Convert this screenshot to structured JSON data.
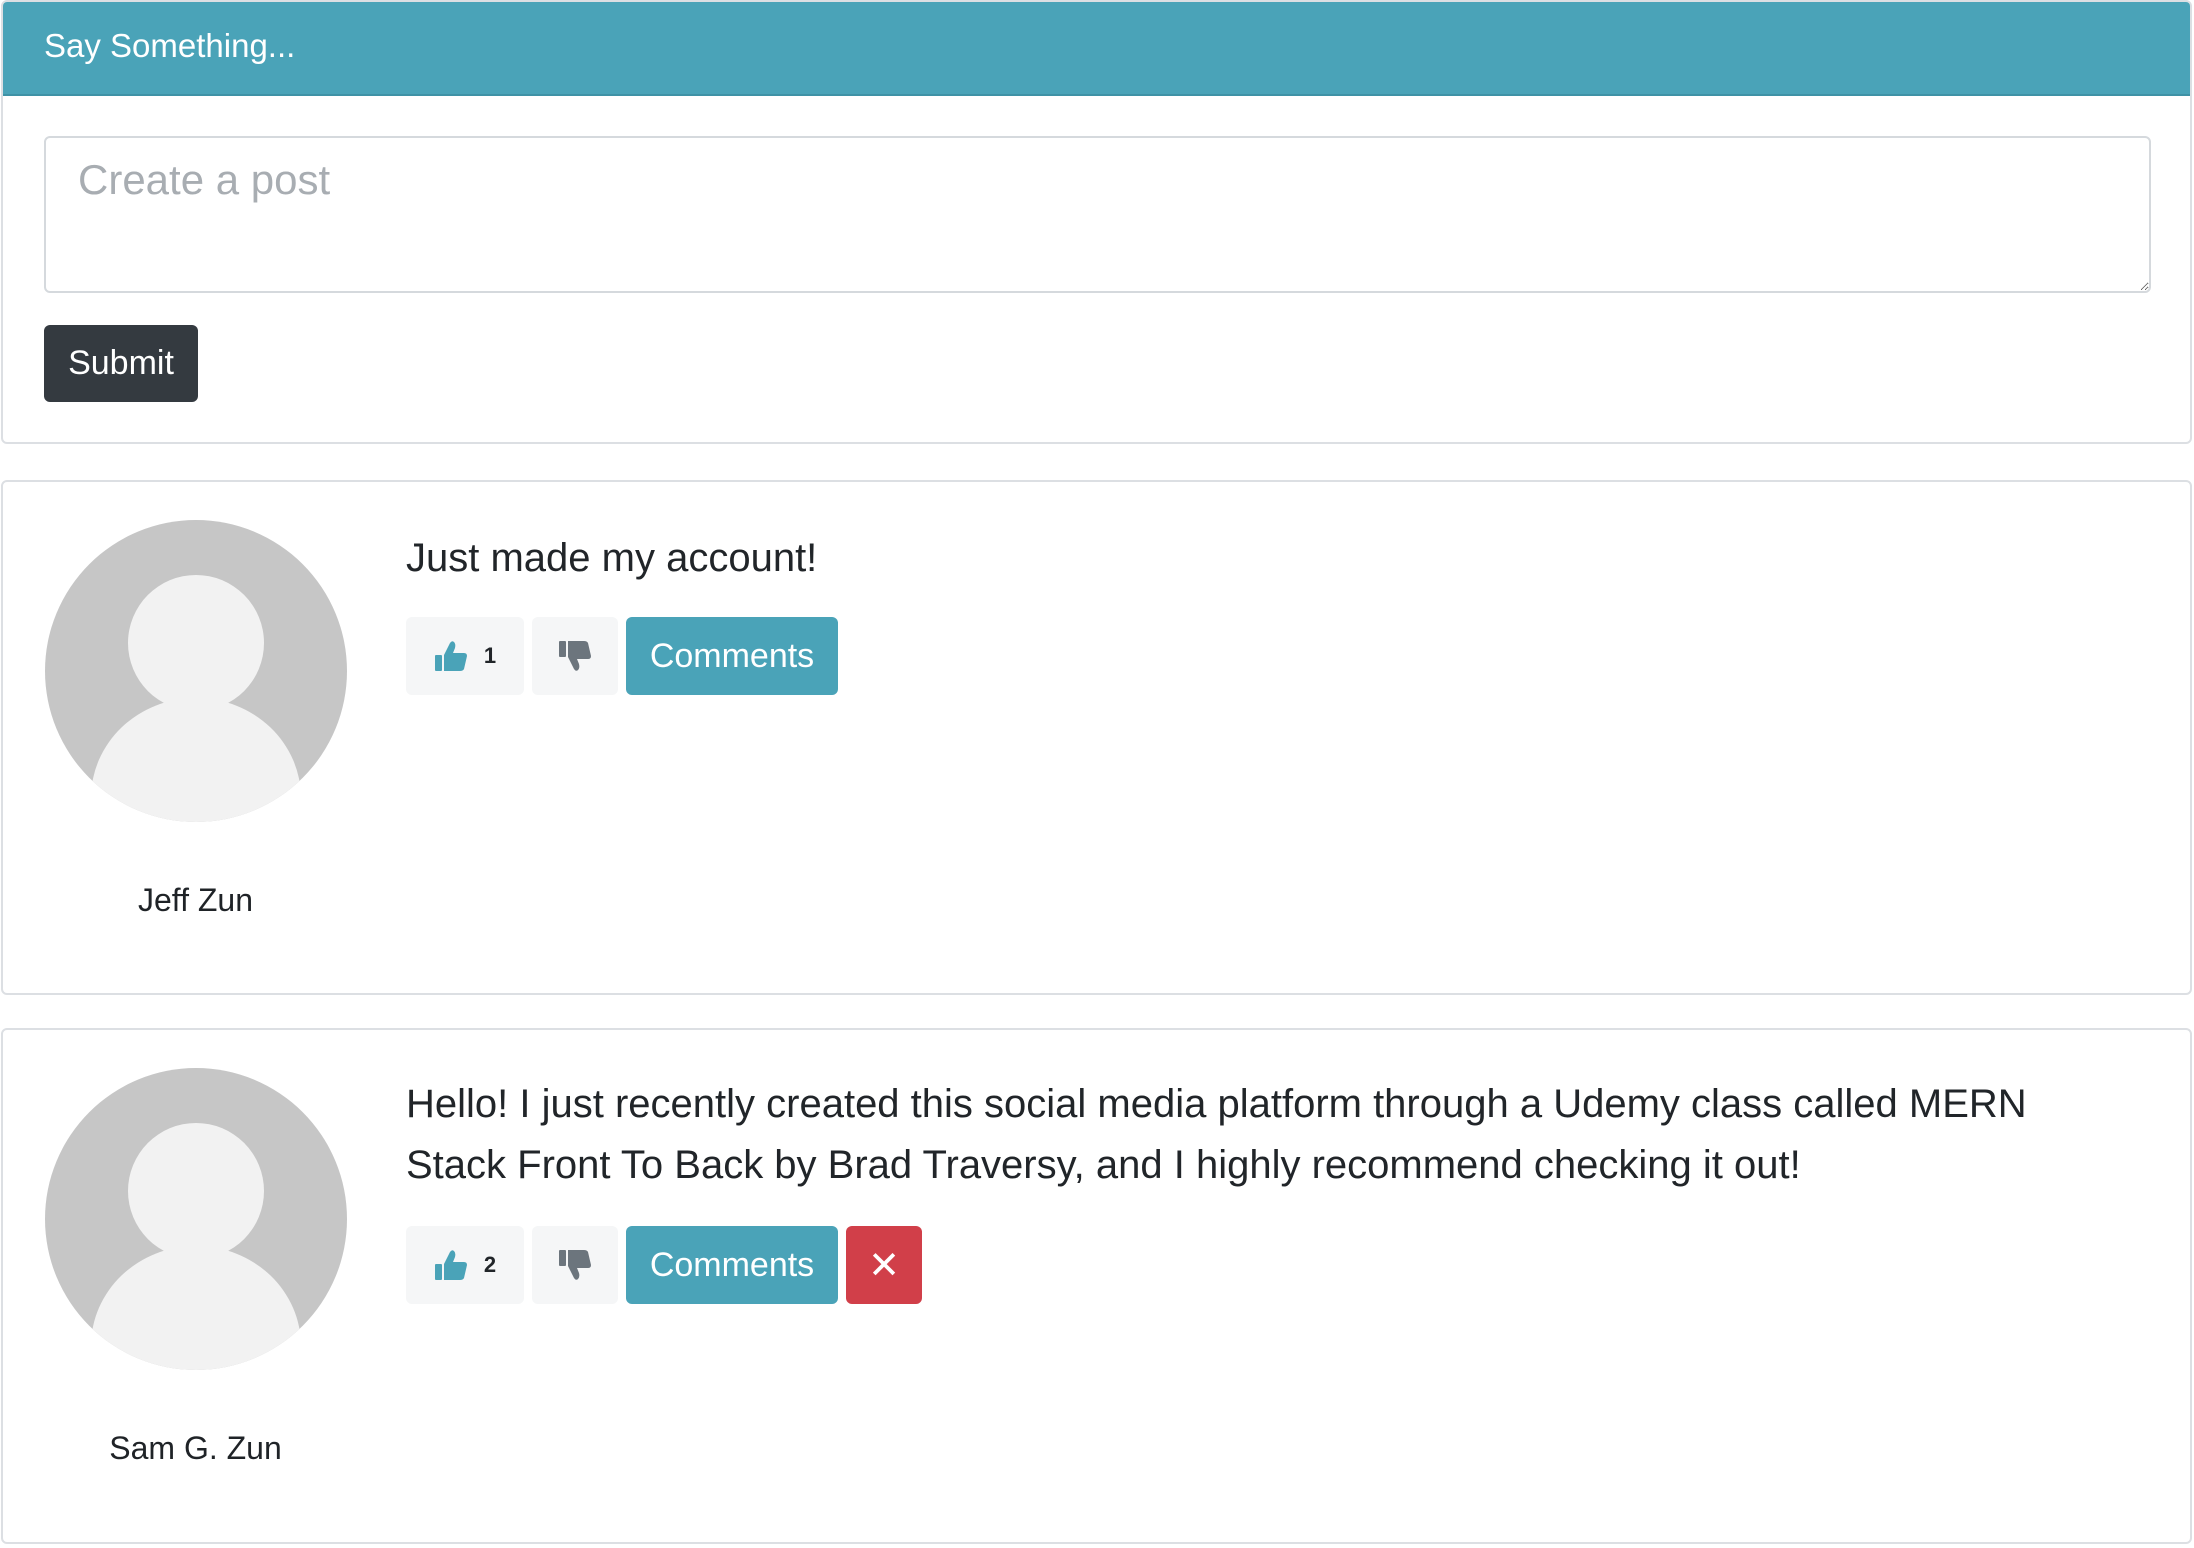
{
  "composer": {
    "header": "Say Something...",
    "placeholder": "Create a post",
    "submit_label": "Submit"
  },
  "colors": {
    "accent": "#4aa3b8",
    "dark": "#343a40",
    "danger": "#d13f49",
    "light": "#f5f6f7"
  },
  "posts": [
    {
      "author": "Jeff Zun",
      "text": "Just made my account!",
      "likes": "1",
      "comments_label": "Comments",
      "like_icon": "thumbs-up-icon",
      "dislike_icon": "thumbs-down-icon"
    },
    {
      "author": "Sam G. Zun",
      "text": "Hello! I just recently created this social media platform through a Udemy class called MERN Stack Front To Back by Brad Traversy, and I highly recommend checking it out!",
      "likes": "2",
      "comments_label": "Comments",
      "delete_label": "✕",
      "like_icon": "thumbs-up-icon",
      "dislike_icon": "thumbs-down-icon"
    }
  ]
}
